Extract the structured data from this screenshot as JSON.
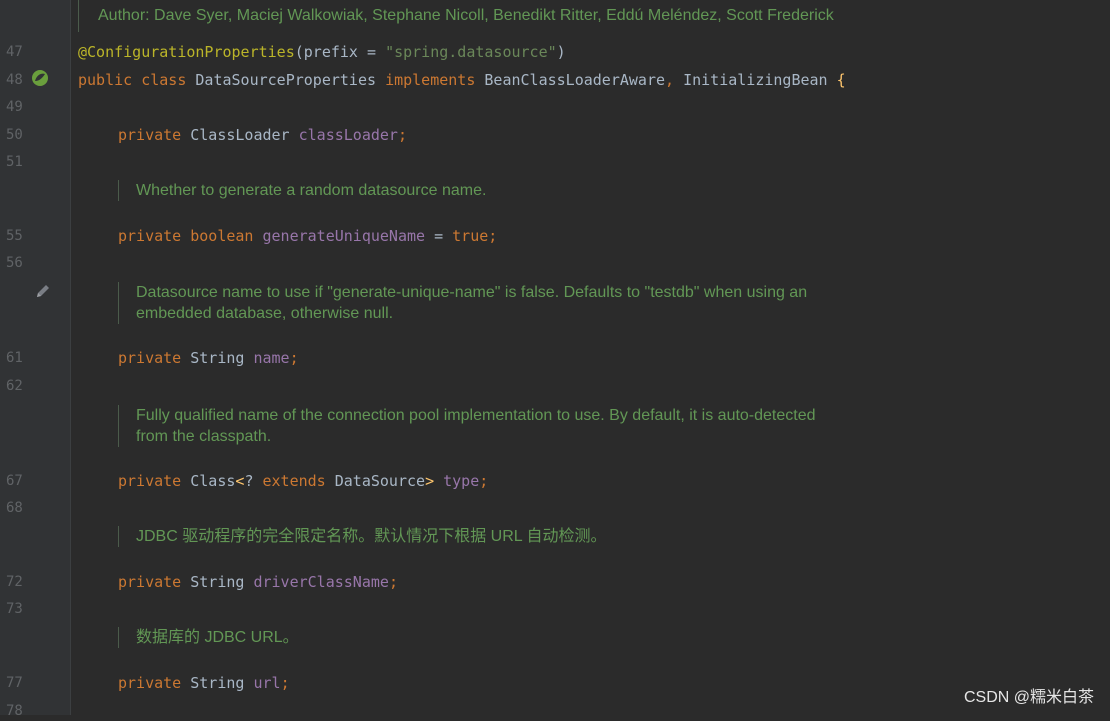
{
  "author_line": "Author: Dave Syer, Maciej Walkowiak, Stephane Nicoll, Benedikt Ritter, Eddú Meléndez, Scott Frederick",
  "gutter": {
    "line_numbers": [
      "47",
      "48",
      "49",
      "50",
      "51",
      "55",
      "56",
      "61",
      "62",
      "67",
      "68",
      "72",
      "73",
      "77",
      "78"
    ],
    "bean_icon": "spring-bean-icon",
    "edit_icon": "pencil-icon"
  },
  "code": {
    "l47": {
      "annotation": "@ConfigurationProperties",
      "open": "(",
      "attr": "prefix = ",
      "string": "\"spring.datasource\"",
      "close": ")"
    },
    "l48": {
      "public": "public",
      "class": "class",
      "name": "DataSourceProperties",
      "implements": "implements",
      "iface1": "BeanClassLoaderAware",
      "comma": ",",
      "iface2": "InitializingBean",
      "brace": "{"
    },
    "l50": {
      "private": "private",
      "type": "ClassLoader",
      "field": "classLoader",
      "semi": ";"
    },
    "l55": {
      "private": "private",
      "type": "boolean",
      "field": "generateUniqueName",
      "eq": " = ",
      "value": "true",
      "semi": ";"
    },
    "l61": {
      "private": "private",
      "type": "String",
      "field": "name",
      "semi": ";"
    },
    "l67": {
      "private": "private",
      "type1": "Class",
      "lt": "<",
      "q": "? ",
      "ext": "extends",
      "type2": "DataSource",
      "gt": ">",
      "field": "type",
      "semi": ";"
    },
    "l72": {
      "private": "private",
      "type": "String",
      "field": "driverClassName",
      "semi": ";"
    },
    "l77": {
      "private": "private",
      "type": "String",
      "field": "url",
      "semi": ";"
    }
  },
  "docs": {
    "d1": [
      "Whether to generate a random datasource name."
    ],
    "d2": [
      "Datasource name to use if \"generate-unique-name\" is false. Defaults to \"testdb\" when using an",
      "embedded database, otherwise null."
    ],
    "d3": [
      "Fully qualified name of the connection pool implementation to use. By default, it is auto-detected",
      "from the classpath."
    ],
    "d4": [
      "JDBC 驱动程序的完全限定名称。默认情况下根据 URL 自动检测。"
    ],
    "d5": [
      "数据库的 JDBC URL。"
    ]
  },
  "watermark": "CSDN @糯米白茶",
  "colors": {
    "background": "#2b2b2b",
    "gutter": "#313335",
    "keyword": "#cc7832",
    "field": "#9876aa",
    "string": "#6a8759",
    "annotation": "#bbb529",
    "doc": "#629755"
  }
}
